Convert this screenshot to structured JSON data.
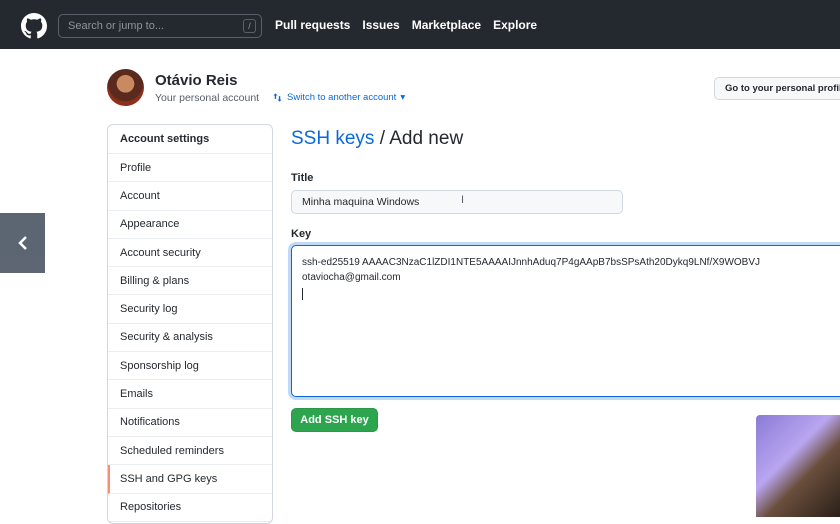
{
  "header": {
    "search_placeholder": "Search or jump to...",
    "search_shortcut": "/",
    "nav": [
      "Pull requests",
      "Issues",
      "Marketplace",
      "Explore"
    ]
  },
  "user": {
    "name": "Otávio Reis",
    "subtitle": "Your personal account",
    "switch_label": "Switch to another account",
    "profile_button": "Go to your personal profile"
  },
  "sidebar": {
    "heading": "Account settings",
    "items": [
      "Profile",
      "Account",
      "Appearance",
      "Account security",
      "Billing & plans",
      "Security log",
      "Security & analysis",
      "Sponsorship log",
      "Emails",
      "Notifications",
      "Scheduled reminders",
      "SSH and GPG keys",
      "Repositories"
    ],
    "active": "SSH and GPG keys"
  },
  "main": {
    "breadcrumb": "SSH keys",
    "separator": " / ",
    "page": "Add new",
    "title_label": "Title",
    "title_value": "Minha maquina Windows",
    "key_label": "Key",
    "key_line1": "ssh-ed25519 AAAAC3NzaC1lZDI1NTE5AAAAIJnnhAduq7P4gAApB7bsSPsAth20Dykq9LNf/X9WOBVJ",
    "key_line2": "otaviocha@gmail.com",
    "submit_label": "Add SSH key"
  },
  "colors": {
    "header_bg": "#24292f",
    "link": "#0969da",
    "primary_button": "#2da44e",
    "active_marker": "#fd8c73"
  }
}
